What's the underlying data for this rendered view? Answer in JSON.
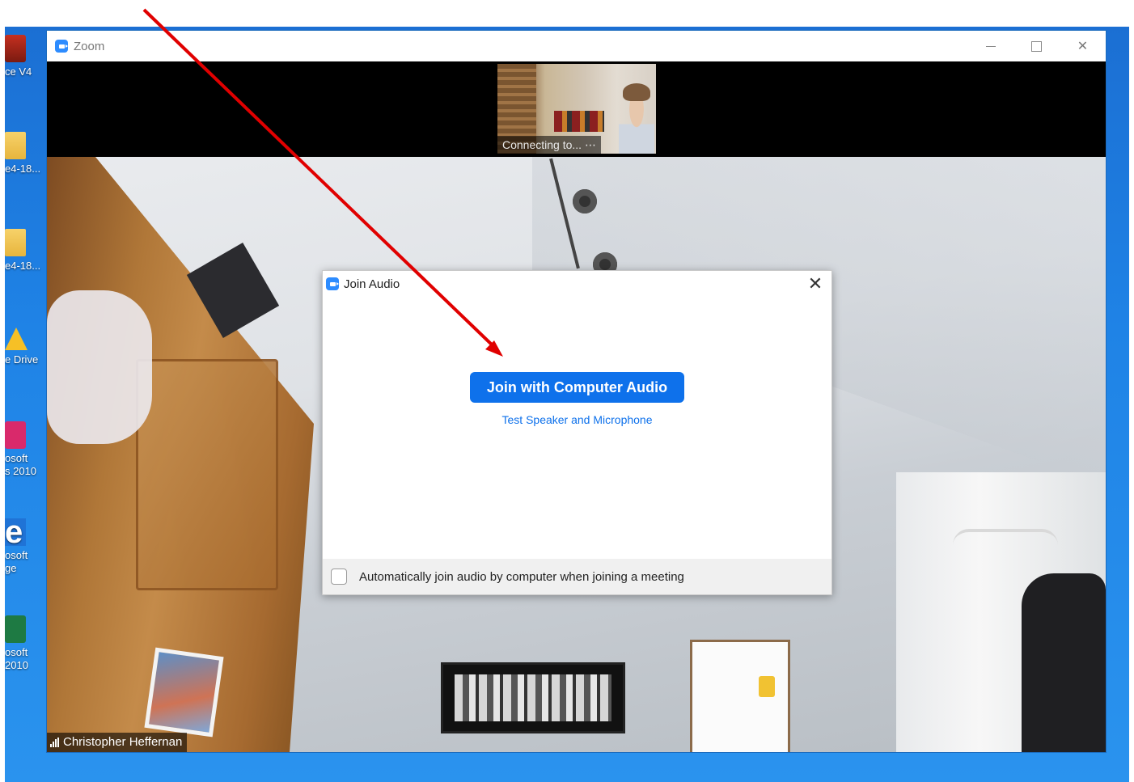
{
  "desktop": {
    "icons": [
      {
        "label": "ce V4",
        "icon": "game-icon"
      },
      {
        "label": "e4-18...",
        "icon": "zip-folder-icon"
      },
      {
        "label": "e4-18...",
        "icon": "zip-folder-icon"
      },
      {
        "label": "e Drive",
        "icon": "google-drive-icon"
      },
      {
        "label": "osoft\ns 2010",
        "icon": "publisher-icon"
      },
      {
        "label": "osoft\nge",
        "icon": "edge-icon"
      },
      {
        "label": "osoft\n2010",
        "icon": "excel-icon"
      }
    ]
  },
  "window": {
    "title": "Zoom",
    "minimize_icon": "minimize-icon",
    "maximize_icon": "maximize-icon",
    "close_glyph": "✕"
  },
  "thumbnail": {
    "label": "Connecting to... ⋯"
  },
  "main_video": {
    "participant_name": "Christopher Heffernan"
  },
  "dialog": {
    "title": "Join Audio",
    "close_glyph": "✕",
    "join_button": "Join with Computer Audio",
    "test_link": "Test Speaker and Microphone",
    "auto_join_label": "Automatically join audio by computer when joining a meeting",
    "auto_join_checked": false
  },
  "colors": {
    "zoom_blue": "#0e71eb",
    "annotation_red": "#e00000",
    "desktop_blue": "#1f83e6"
  }
}
